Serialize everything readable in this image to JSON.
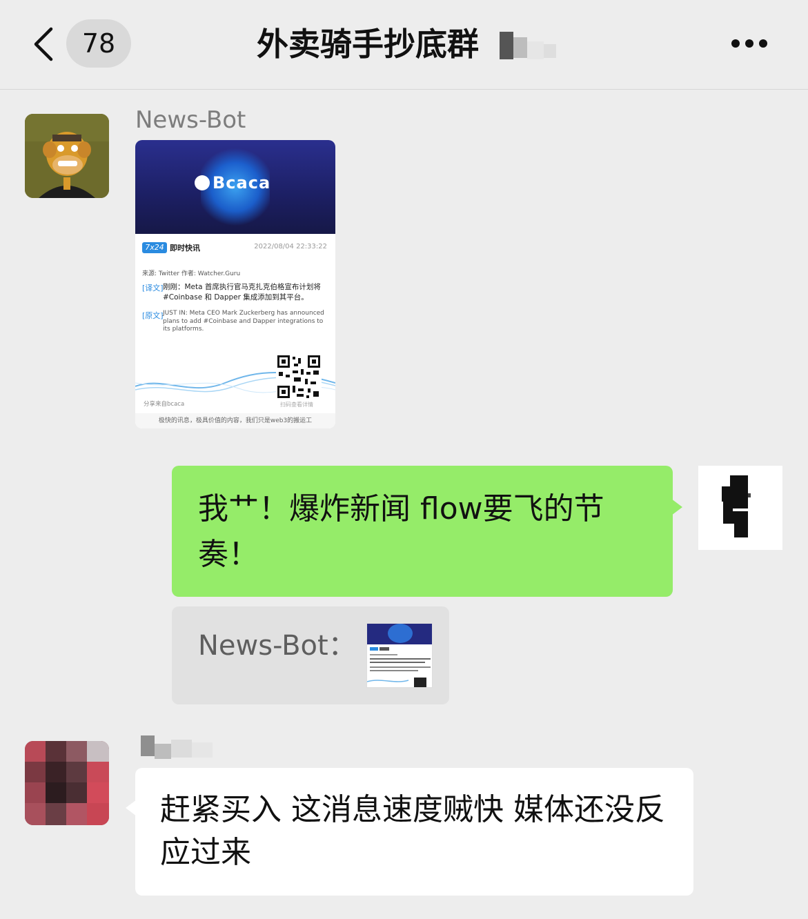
{
  "header": {
    "unread_count": "78",
    "title": "外卖骑手抄底群"
  },
  "messages": [
    {
      "sender": "News-Bot",
      "type": "image",
      "card": {
        "logo": "Bcaca",
        "tag": "7x24",
        "tag_label": "即时快讯",
        "date": "2022/08/04 22:33:22",
        "source": "来源: Twitter   作者: Watcher.Guru",
        "trans_tag": "[译文]",
        "trans_text": "刚刚：Meta 首席执行官马克扎克伯格宣布计划将#Coinbase 和 Dapper 集成添加到其平台。",
        "orig_tag": "[原文]",
        "orig_text": "JUST IN: Meta CEO Mark Zuckerberg has announced plans to add #Coinbase and Dapper integrations to its platforms.",
        "share": "分享来自bcaca",
        "qr_label": "扫码查看详情",
        "footer": "极快的讯息，极具价值的内容，我们只是web3的搬运工"
      }
    },
    {
      "sender": "me",
      "type": "text",
      "text": "我艹！爆炸新闻 flow要飞的节奏！",
      "quote_label": "News-Bot："
    },
    {
      "sender": "",
      "type": "text",
      "text": "赶紧买入 这消息速度贼快 媒体还没反应过来"
    }
  ],
  "colors": {
    "background": "#ededed",
    "sent_bubble": "#95ec69",
    "received_bubble": "#ffffff",
    "quote_box": "#e1e1e1"
  }
}
